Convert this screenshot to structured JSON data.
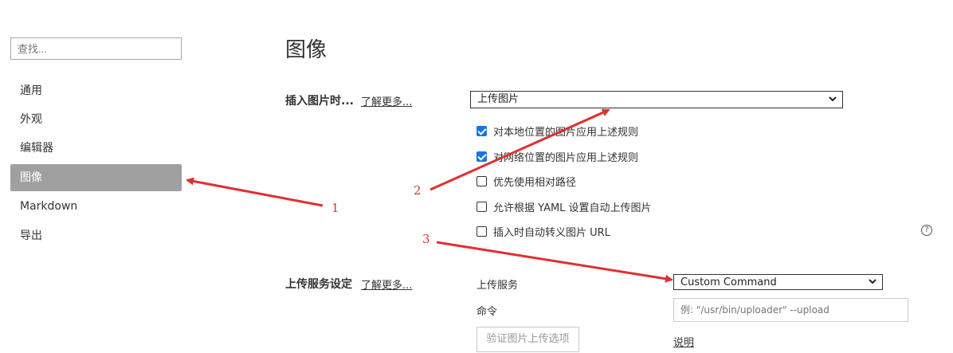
{
  "sidebar": {
    "search_placeholder": "查找...",
    "items": [
      {
        "label": "通用"
      },
      {
        "label": "外观"
      },
      {
        "label": "编辑器"
      },
      {
        "label": "图像"
      },
      {
        "label": "Markdown"
      },
      {
        "label": "导出"
      }
    ],
    "active_index": 3
  },
  "main": {
    "title": "图像",
    "insert_section": {
      "label": "插入图片时...",
      "learn_more": "了解更多...",
      "select_value": "上传图片",
      "options": [
        {
          "label": "对本地位置的图片应用上述规则",
          "checked": true
        },
        {
          "label": "对网络位置的图片应用上述规则",
          "checked": true
        },
        {
          "label": "优先使用相对路径",
          "checked": false
        },
        {
          "label": "允许根据 YAML 设置自动上传图片",
          "checked": false
        },
        {
          "label": "插入时自动转义图片 URL",
          "checked": false
        }
      ],
      "help": "?"
    },
    "upload_section": {
      "label": "上传服务设定",
      "learn_more": "了解更多...",
      "service_label": "上传服务",
      "service_value": "Custom Command",
      "command_label": "命令",
      "command_placeholder": "例: \"/usr/bin/uploader\" --upload",
      "verify_button": "验证图片上传选项",
      "explain_link": "说明"
    }
  },
  "annotations": {
    "labels": [
      "1",
      "2",
      "3"
    ],
    "color": "#e03030"
  },
  "colors": {
    "active_bg": "#a0a0a0",
    "checkbox": "#1a73e8"
  }
}
